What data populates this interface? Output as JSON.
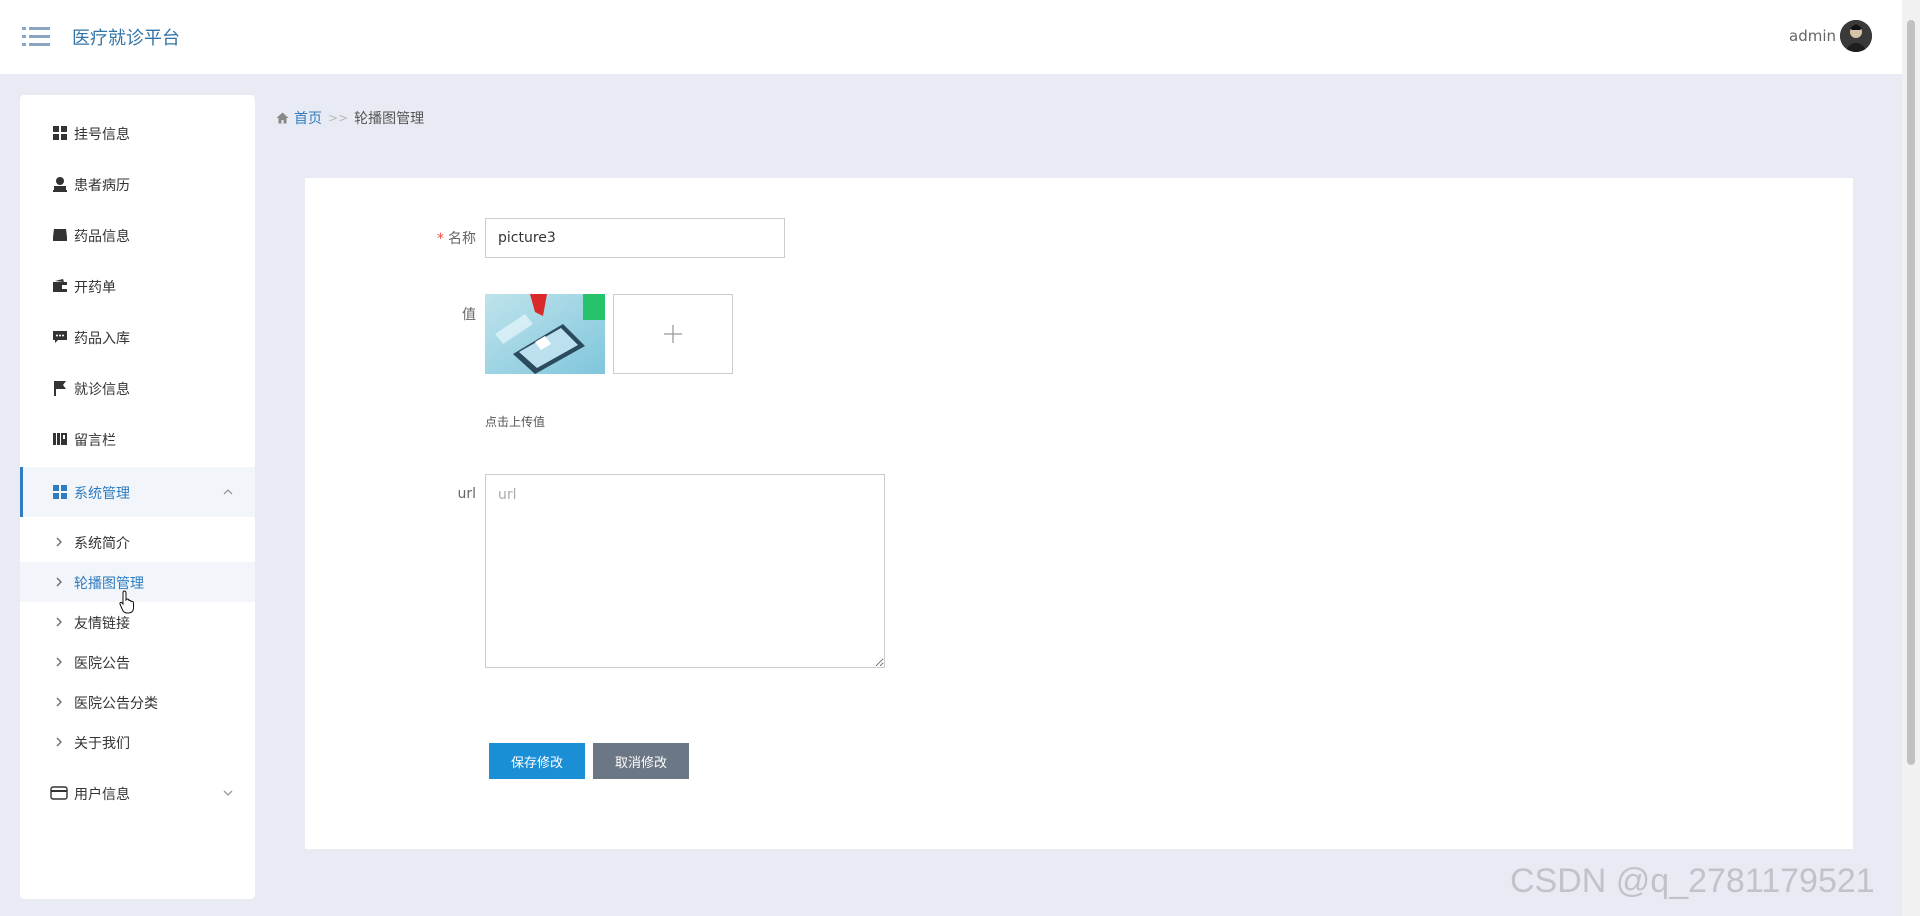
{
  "header": {
    "app_title": "医疗就诊平台",
    "user_name": "admin"
  },
  "sidebar": {
    "items": [
      {
        "label": "挂号信息",
        "icon": "grid-icon"
      },
      {
        "label": "患者病历",
        "icon": "user-icon"
      },
      {
        "label": "药品信息",
        "icon": "inbox-icon"
      },
      {
        "label": "开药单",
        "icon": "wallet-icon"
      },
      {
        "label": "药品入库",
        "icon": "comment-icon"
      },
      {
        "label": "就诊信息",
        "icon": "flag-icon"
      },
      {
        "label": "留言栏",
        "icon": "book-icon"
      },
      {
        "label": "系统管理",
        "icon": "grid-icon"
      },
      {
        "label": "用户信息",
        "icon": "card-icon"
      }
    ],
    "sub_items": [
      {
        "label": "系统简介"
      },
      {
        "label": "轮播图管理"
      },
      {
        "label": "友情链接"
      },
      {
        "label": "医院公告"
      },
      {
        "label": "医院公告分类"
      },
      {
        "label": "关于我们"
      }
    ]
  },
  "breadcrumb": {
    "home": "首页",
    "separator": ">>",
    "current": "轮播图管理"
  },
  "form": {
    "name_label": "名称",
    "name_required_mark": "*",
    "name_value": "picture3",
    "value_label": "值",
    "upload_hint": "点击上传值",
    "url_label": "url",
    "url_placeholder": "url",
    "save_label": "保存修改",
    "cancel_label": "取消修改"
  },
  "watermark": "CSDN @q_2781179521",
  "colors": {
    "accent": "#2f7cc0",
    "save_button": "#1a8fd6",
    "cancel_button": "#6b7785",
    "background": "#e8ebf3"
  }
}
